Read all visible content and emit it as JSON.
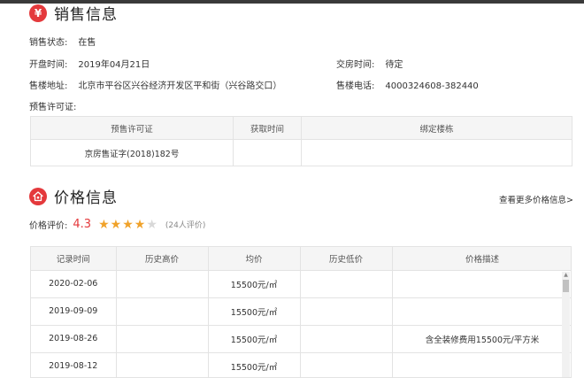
{
  "sales": {
    "icon_symbol": "¥",
    "title": "销售信息",
    "status_label": "销售状态:",
    "status_value": "在售",
    "open_label": "开盘时间:",
    "open_value": "2019年04月21日",
    "delivery_label": "交房时间:",
    "delivery_value": "待定",
    "address_label": "售楼地址:",
    "address_value": "北京市平谷区兴谷经济开发区平和街（兴谷路交口）",
    "phone_label": "售楼电话:",
    "phone_value": "4000324608-382440",
    "permit_label": "预售许可证:"
  },
  "permit_table": {
    "headers": [
      "预售许可证",
      "获取时间",
      "绑定楼栋"
    ],
    "rows": [
      [
        "京房售证字(2018)182号",
        "",
        ""
      ]
    ]
  },
  "price": {
    "title": "价格信息",
    "more_link": "查看更多价格信息>",
    "rating_label": "价格评价:",
    "rating_score": "4.3",
    "rating_stars": 4.3,
    "rating_count": "(24人评价)"
  },
  "price_table": {
    "headers": [
      "记录时间",
      "历史高价",
      "均价",
      "历史低价",
      "价格描述"
    ],
    "rows": [
      [
        "2020-02-06",
        "",
        "15500元/㎡",
        "",
        ""
      ],
      [
        "2019-09-09",
        "",
        "15500元/㎡",
        "",
        ""
      ],
      [
        "2019-08-26",
        "",
        "15500元/㎡",
        "",
        "含全装修费用15500元/平方米"
      ],
      [
        "2019-08-12",
        "",
        "15500元/㎡",
        "",
        ""
      ]
    ]
  },
  "colors": {
    "accent": "#e4393c",
    "star": "#f0a22a"
  }
}
